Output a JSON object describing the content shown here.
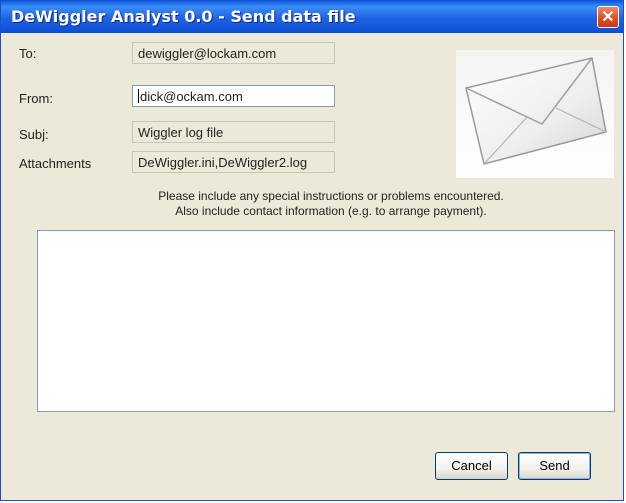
{
  "window": {
    "title": "DeWiggler Analyst 0.0 - Send data file",
    "close_glyph": "✕"
  },
  "form": {
    "to_label": "To:",
    "to_value": "dewiggler@lockam.com",
    "from_label": "From:",
    "from_value": "dick@ockam.com",
    "subj_label": "Subj:",
    "subj_value": "Wiggler log file",
    "attachments_label": "Attachments",
    "attachments_value": "DeWiggler.ini,DeWiggler2.log"
  },
  "instructions": {
    "line1": "Please include any special instructions or problems encountered.",
    "line2": "Also include contact information  (e.g. to arrange payment)."
  },
  "message": {
    "value": ""
  },
  "buttons": {
    "cancel_label": "Cancel",
    "send_label": "Send"
  },
  "icons": {
    "envelope": "envelope-icon",
    "close": "close-icon"
  },
  "colors": {
    "titlebar": "#1f62e2",
    "close_button": "#e04e24",
    "dialog_background": "#ece9d8"
  }
}
